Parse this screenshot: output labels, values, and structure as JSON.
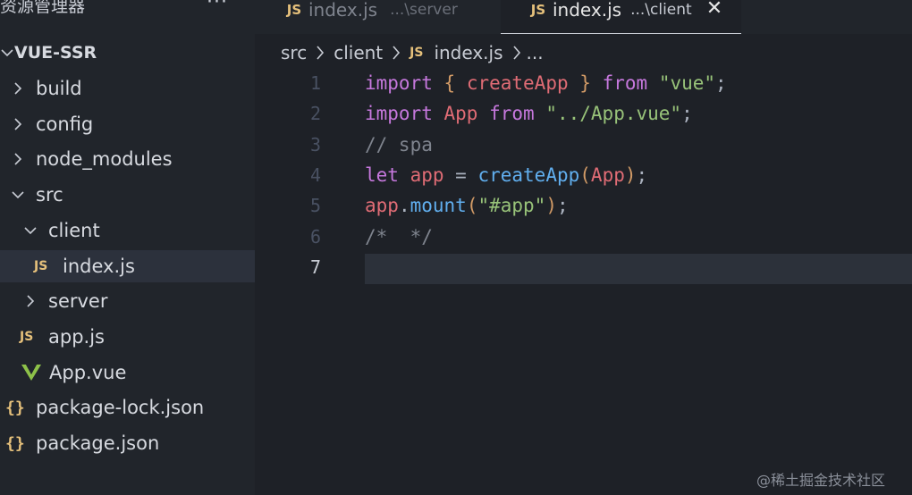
{
  "sidebar": {
    "title": "资源管理器",
    "more": "···",
    "root": "VUE-SSR",
    "items": [
      {
        "label": "build",
        "kind": "folder",
        "expanded": false,
        "depth": 0
      },
      {
        "label": "config",
        "kind": "folder",
        "expanded": false,
        "depth": 0
      },
      {
        "label": "node_modules",
        "kind": "folder",
        "expanded": false,
        "depth": 0
      },
      {
        "label": "src",
        "kind": "folder",
        "expanded": true,
        "depth": 0
      },
      {
        "label": "client",
        "kind": "folder",
        "expanded": true,
        "depth": 1
      },
      {
        "label": "index.js",
        "kind": "js",
        "depth": 2,
        "selected": true
      },
      {
        "label": "server",
        "kind": "folder",
        "expanded": false,
        "depth": 1
      },
      {
        "label": "app.js",
        "kind": "js",
        "depth": 1
      },
      {
        "label": "App.vue",
        "kind": "vue",
        "depth": 1
      },
      {
        "label": "package-lock.json",
        "kind": "json",
        "depth": 0
      },
      {
        "label": "package.json",
        "kind": "json",
        "depth": 0
      }
    ],
    "icon_text": {
      "js": "JS",
      "json": "{}"
    }
  },
  "tabs": [
    {
      "name": "index.js",
      "desc": "...\\server",
      "active": false
    },
    {
      "name": "index.js",
      "desc": "...\\client",
      "active": true,
      "close": "✕"
    }
  ],
  "breadcrumb": [
    "src",
    "client",
    "index.js",
    "..."
  ],
  "editor": {
    "current_line": 7,
    "lines": [
      {
        "n": "1",
        "tokens": [
          [
            "kw",
            "import"
          ],
          [
            "pn",
            " "
          ],
          [
            "br",
            "{"
          ],
          [
            "pn",
            " "
          ],
          [
            "var",
            "createApp"
          ],
          [
            "pn",
            " "
          ],
          [
            "br",
            "}"
          ],
          [
            "pn",
            " "
          ],
          [
            "kw",
            "from"
          ],
          [
            "pn",
            " "
          ],
          [
            "str",
            "\"vue\""
          ],
          [
            "pn",
            ";"
          ]
        ]
      },
      {
        "n": "2",
        "tokens": [
          [
            "kw",
            "import"
          ],
          [
            "pn",
            " "
          ],
          [
            "var",
            "App"
          ],
          [
            "pn",
            " "
          ],
          [
            "kw",
            "from"
          ],
          [
            "pn",
            " "
          ],
          [
            "str",
            "\"../App.vue\""
          ],
          [
            "pn",
            ";"
          ]
        ]
      },
      {
        "n": "3",
        "tokens": [
          [
            "cm",
            "// spa"
          ]
        ]
      },
      {
        "n": "4",
        "tokens": [
          [
            "kw",
            "let"
          ],
          [
            "pn",
            " "
          ],
          [
            "var",
            "app"
          ],
          [
            "pn",
            " = "
          ],
          [
            "fn",
            "createApp"
          ],
          [
            "br",
            "("
          ],
          [
            "var",
            "App"
          ],
          [
            "br",
            ")"
          ],
          [
            "pn",
            ";"
          ]
        ]
      },
      {
        "n": "5",
        "tokens": [
          [
            "var",
            "app"
          ],
          [
            "pn",
            "."
          ],
          [
            "fn",
            "mount"
          ],
          [
            "br",
            "("
          ],
          [
            "str",
            "\"#app\""
          ],
          [
            "br",
            ")"
          ],
          [
            "pn",
            ";"
          ]
        ]
      },
      {
        "n": "6",
        "tokens": [
          [
            "cm",
            "/*  */"
          ]
        ]
      },
      {
        "n": "7",
        "tokens": []
      }
    ]
  },
  "colors": {
    "keyword": "#c678dd",
    "variable": "#e06c75",
    "string": "#98c379",
    "function": "#61afef",
    "bracket": "#d19a66",
    "comment": "#7f848e",
    "js_icon": "#e5c07b",
    "vue_icon": "#8dc149"
  },
  "watermark": "@稀土掘金技术社区"
}
